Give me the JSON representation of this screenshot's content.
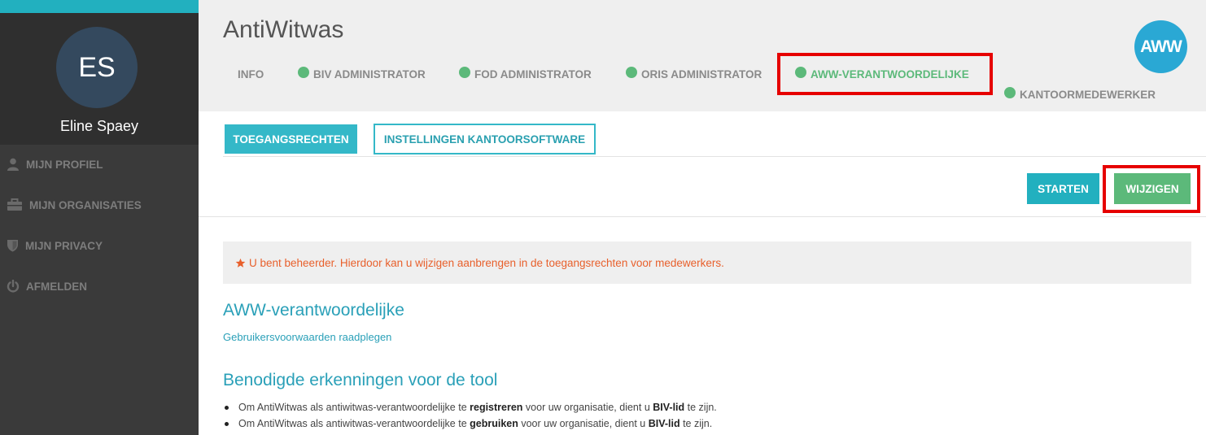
{
  "sidebar": {
    "avatar_initials": "ES",
    "user_name": "Eline Spaey",
    "items": [
      {
        "label": "MIJN PROFIEL",
        "icon": "user-icon"
      },
      {
        "label": "MIJN ORGANISATIES",
        "icon": "briefcase-icon"
      },
      {
        "label": "MIJN PRIVACY",
        "icon": "shield-icon"
      },
      {
        "label": "AFMELDEN",
        "icon": "power-icon"
      }
    ]
  },
  "header": {
    "title": "AntiWitwas",
    "logo_text": "AWW",
    "tabs": [
      {
        "label": "INFO",
        "status": false
      },
      {
        "label": "BIV ADMINISTRATOR",
        "status": true
      },
      {
        "label": "FOD ADMINISTRATOR",
        "status": true
      },
      {
        "label": "ORIS ADMINISTRATOR",
        "status": true
      },
      {
        "label": "AWW-VERANTWOORDELIJKE",
        "status": true,
        "active": true
      },
      {
        "label": "KANTOORMEDEWERKER",
        "status": true
      }
    ]
  },
  "subtabs": [
    {
      "label": "TOEGANGSRECHTEN",
      "active": true
    },
    {
      "label": "INSTELLINGEN KANTOORSOFTWARE",
      "active": false
    }
  ],
  "actions": {
    "start_label": "STARTEN",
    "edit_label": "WIJZIGEN"
  },
  "notice": "U bent beheerder. Hierdoor kan u wijzigen aanbrengen in de toegangsrechten voor medewerkers.",
  "content": {
    "role_title": "AWW-verantwoordelijke",
    "terms_link": "Gebruikersvoorwaarden raadplegen",
    "requirements_title": "Benodigde erkenningen voor de tool",
    "bullets": [
      {
        "pre": "Om AntiWitwas als antiwitwas-verantwoordelijke te ",
        "bold1": "registreren",
        "mid": " voor uw organisatie, dient u ",
        "bold2": "BIV-lid",
        "post": " te zijn."
      },
      {
        "pre": "Om AntiWitwas als antiwitwas-verantwoordelijke te ",
        "bold1": "gebruiken",
        "mid": " voor uw organisatie, dient u ",
        "bold2": "BIV-lid",
        "post": " te zijn."
      }
    ]
  },
  "colors": {
    "accent": "#22b0bf",
    "status_green": "#5cb97a",
    "highlight_red": "#e60000",
    "notice_orange": "#e8602c"
  }
}
